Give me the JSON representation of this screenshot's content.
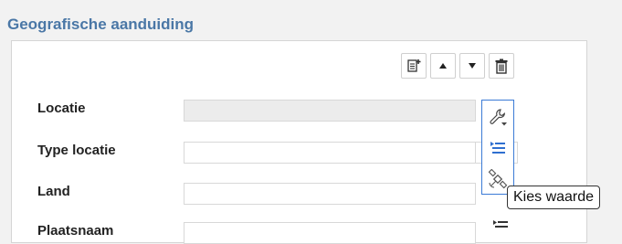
{
  "section": {
    "title": "Geografische aanduiding"
  },
  "toolbar": {
    "buttons": [
      {
        "name": "add-entry-button",
        "icon": "document-add-icon"
      },
      {
        "name": "move-up-button",
        "icon": "triangle-up-icon"
      },
      {
        "name": "move-down-button",
        "icon": "triangle-down-icon"
      },
      {
        "name": "delete-button",
        "icon": "trash-icon"
      }
    ]
  },
  "fields": [
    {
      "label": "Locatie",
      "value": "",
      "disabled": true
    },
    {
      "label": "Type locatie",
      "value": ""
    },
    {
      "label": "Land",
      "value": ""
    },
    {
      "label": "Plaatsnaam",
      "value": ""
    }
  ],
  "action_menu": {
    "items": [
      {
        "icon": "wrench-icon"
      },
      {
        "icon": "list-icon"
      },
      {
        "icon": "satellite-icon"
      }
    ]
  },
  "tooltip": {
    "text": "Kies waarde"
  },
  "colors": {
    "title": "#4a77a6",
    "menu_border": "#3b7bd6",
    "icon_blue": "#2f6fd0"
  }
}
